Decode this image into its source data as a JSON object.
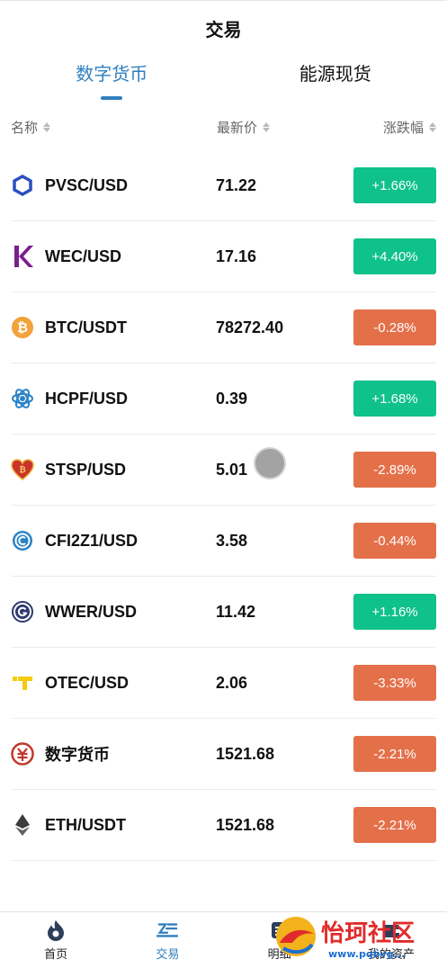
{
  "header": {
    "title": "交易"
  },
  "tabs": [
    {
      "label": "数字货币",
      "active": true
    },
    {
      "label": "能源现货",
      "active": false
    }
  ],
  "columns": {
    "name": "名称",
    "price": "最新价",
    "change": "涨跌幅"
  },
  "rows": [
    {
      "name": "PVSC/USD",
      "price": "71.22",
      "change": "+1.66%",
      "dir": "up",
      "icon": "hexagon-icon"
    },
    {
      "name": "WEC/USD",
      "price": "17.16",
      "change": "+4.40%",
      "dir": "up",
      "icon": "k-logo-icon"
    },
    {
      "name": "BTC/USDT",
      "price": "78272.40",
      "change": "-0.28%",
      "dir": "down",
      "icon": "bitcoin-icon"
    },
    {
      "name": "HCPF/USD",
      "price": "0.39",
      "change": "+1.68%",
      "dir": "up",
      "icon": "flower-icon"
    },
    {
      "name": "STSP/USD",
      "price": "5.01",
      "change": "-2.89%",
      "dir": "down",
      "icon": "heart-icon"
    },
    {
      "name": "CFI2Z1/USD",
      "price": "3.58",
      "change": "-0.44%",
      "dir": "down",
      "icon": "c-coin-icon"
    },
    {
      "name": "WWER/USD",
      "price": "11.42",
      "change": "+1.16%",
      "dir": "up",
      "icon": "g-coin-icon"
    },
    {
      "name": "OTEC/USD",
      "price": "2.06",
      "change": "-3.33%",
      "dir": "down",
      "icon": "t-logo-icon"
    },
    {
      "name": "数字货币",
      "price": "1521.68",
      "change": "-2.21%",
      "dir": "down",
      "icon": "yuan-icon"
    },
    {
      "name": "ETH/USDT",
      "price": "1521.68",
      "change": "-2.21%",
      "dir": "down",
      "icon": "ethereum-icon"
    }
  ],
  "nav": [
    {
      "label": "首页",
      "icon": "home-flame-icon",
      "active": false
    },
    {
      "label": "交易",
      "icon": "trade-icon",
      "active": true
    },
    {
      "label": "明细",
      "icon": "details-icon",
      "active": false
    },
    {
      "label": "我的资产",
      "icon": "assets-icon",
      "active": false
    }
  ],
  "watermark": {
    "text": "怡珂社区",
    "sub": "www.pqbvg..."
  },
  "colors": {
    "accent": "#2f7fbe",
    "up": "#0fc18a",
    "down": "#e4704a"
  }
}
